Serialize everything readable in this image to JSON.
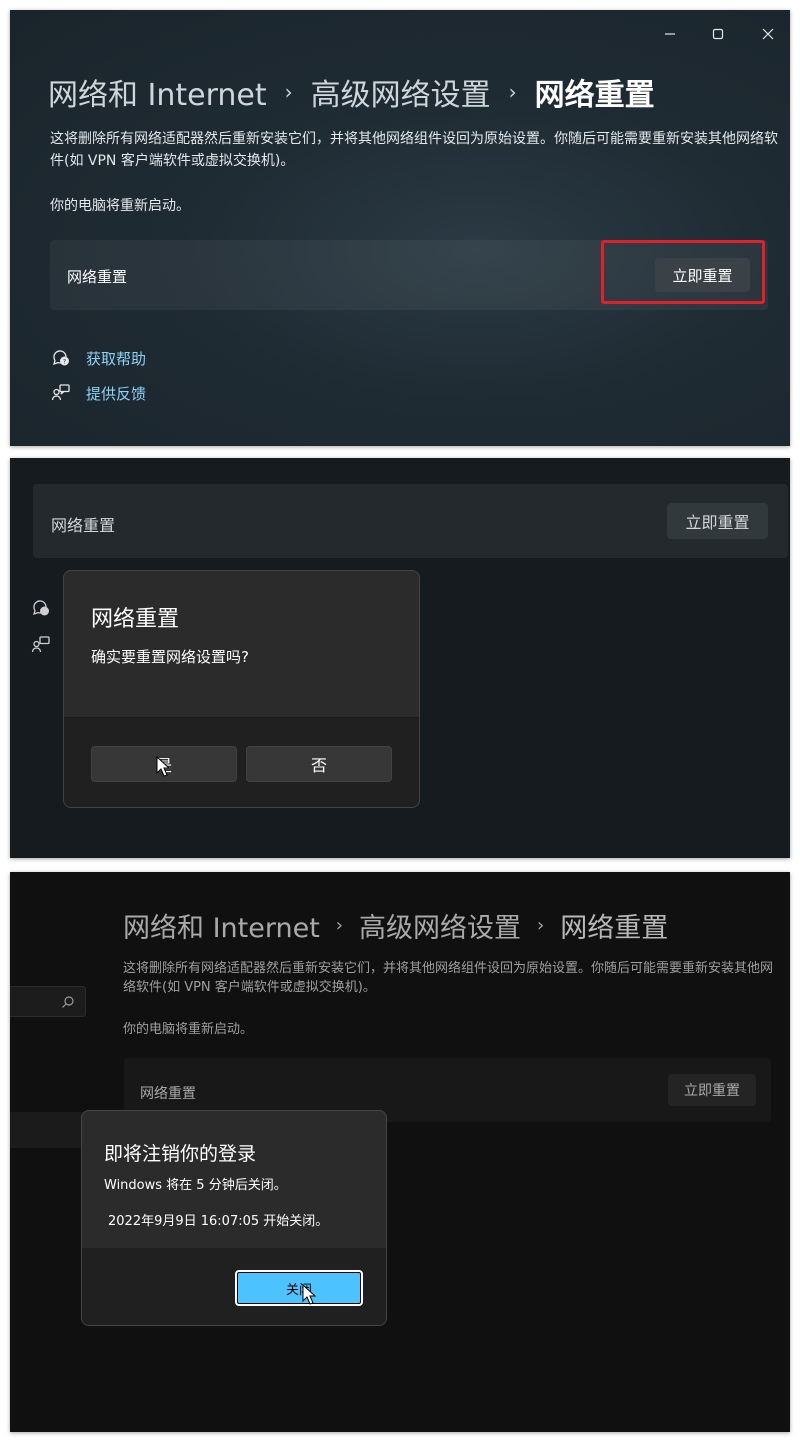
{
  "panel1": {
    "window_controls": {
      "minimize_icon": "minimize-icon",
      "maximize_icon": "maximize-icon",
      "close_icon": "close-icon"
    },
    "breadcrumb": [
      "网络和 Internet",
      "高级网络设置",
      "网络重置"
    ],
    "breadcrumb_separator": "›",
    "description": "这将删除所有网络适配器然后重新安装它们，并将其他网络组件设回为原始设置。你随后可能需要重新安装其他网络软件(如 VPN 客户端软件或虚拟交换机)。",
    "restart_note": "你的电脑将重新启动。",
    "reset_card": {
      "label": "网络重置",
      "button": "立即重置"
    },
    "highlight_color": "#e0202a",
    "links": [
      {
        "label": "获取帮助",
        "icon": "help-icon"
      },
      {
        "label": "提供反馈",
        "icon": "feedback-icon"
      }
    ]
  },
  "panel2": {
    "reset_card": {
      "label": "网络重置",
      "button": "立即重置"
    },
    "dialog": {
      "title": "网络重置",
      "message": "确实要重置网络设置吗?",
      "yes_button": "是",
      "no_button": "否"
    }
  },
  "panel3": {
    "breadcrumb": [
      "网络和 Internet",
      "高级网络设置",
      "网络重置"
    ],
    "breadcrumb_separator": "›",
    "description": "这将删除所有网络适配器然后重新安装它们，并将其他网络组件设回为原始设置。你随后可能需要重新安装其他网络软件(如 VPN 客户端软件或虚拟交换机)。",
    "restart_note": "你的电脑将重新启动。",
    "search_icon": "search-icon",
    "reset_card": {
      "label": "网络重置",
      "button": "立即重置"
    },
    "dialog": {
      "title": "即将注销你的登录",
      "line1": "Windows 将在 5 分钟后关闭。",
      "line2": "2022年9月9日 16:07:05 开始关闭。",
      "close_button": "关闭"
    },
    "accent_color": "#4cc2ff"
  }
}
